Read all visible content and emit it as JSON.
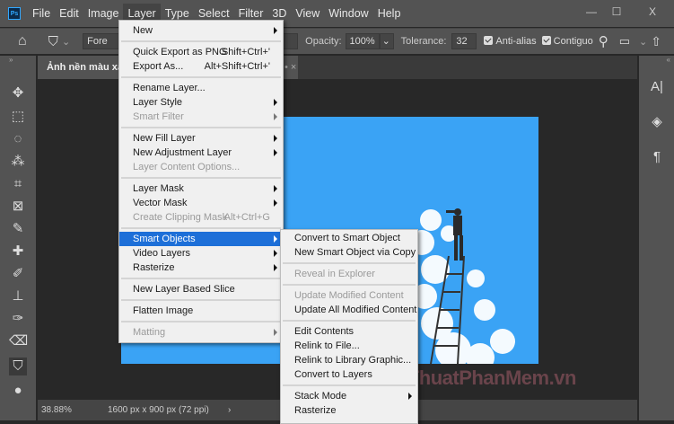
{
  "app": {
    "logo": "Ps"
  },
  "menubar": [
    "File",
    "Edit",
    "Image",
    "Layer",
    "Type",
    "Select",
    "Filter",
    "3D",
    "View",
    "Window",
    "Help"
  ],
  "window_controls": {
    "minimize": "—",
    "maximize": "☐",
    "close": "X"
  },
  "options": {
    "mode_value": "Fore",
    "opacity_label": "Opacity:",
    "opacity_value": "100%",
    "tolerance_label": "Tolerance:",
    "tolerance_value": "32",
    "antialias_label": "Anti-alias",
    "contiguous_label": "Contiguo"
  },
  "document": {
    "tab_title": "Ảnh nền màu xan",
    "zoom": "38.88%",
    "size_info": "1600 px x 900 px (72 ppi)"
  },
  "layer_menu": [
    {
      "label": "New",
      "submenu": true
    },
    {
      "sep": true
    },
    {
      "label": "Quick Export as PNG",
      "shortcut": "Shift+Ctrl+'"
    },
    {
      "label": "Export As...",
      "shortcut": "Alt+Shift+Ctrl+'"
    },
    {
      "sep": true
    },
    {
      "label": "Rename Layer..."
    },
    {
      "label": "Layer Style",
      "submenu": true
    },
    {
      "label": "Smart Filter",
      "submenu": true,
      "disabled": true
    },
    {
      "sep": true
    },
    {
      "label": "New Fill Layer",
      "submenu": true
    },
    {
      "label": "New Adjustment Layer",
      "submenu": true
    },
    {
      "label": "Layer Content Options...",
      "disabled": true
    },
    {
      "sep": true
    },
    {
      "label": "Layer Mask",
      "submenu": true
    },
    {
      "label": "Vector Mask",
      "submenu": true
    },
    {
      "label": "Create Clipping Mask",
      "shortcut": "Alt+Ctrl+G",
      "disabled": true
    },
    {
      "sep": true
    },
    {
      "label": "Smart Objects",
      "submenu": true,
      "highlighted": true
    },
    {
      "label": "Video Layers",
      "submenu": true
    },
    {
      "label": "Rasterize",
      "submenu": true
    },
    {
      "sep": true
    },
    {
      "label": "New Layer Based Slice"
    },
    {
      "sep": true
    },
    {
      "label": "Flatten Image"
    },
    {
      "sep": true
    },
    {
      "label": "Matting",
      "submenu": true,
      "disabled": true
    }
  ],
  "smart_objects_menu": [
    {
      "label": "Convert to Smart Object"
    },
    {
      "label": "New Smart Object via Copy"
    },
    {
      "sep": true
    },
    {
      "label": "Reveal in Explorer",
      "disabled": true
    },
    {
      "sep": true
    },
    {
      "label": "Update Modified Content",
      "disabled": true
    },
    {
      "label": "Update All Modified Content"
    },
    {
      "sep": true
    },
    {
      "label": "Edit Contents"
    },
    {
      "label": "Relink to File..."
    },
    {
      "label": "Relink to Library Graphic..."
    },
    {
      "label": "Convert to Layers"
    },
    {
      "sep": true
    },
    {
      "label": "Stack Mode",
      "submenu": true
    },
    {
      "label": "Rasterize"
    }
  ],
  "watermark": "ThuThuatPhanMem.vn",
  "colors": {
    "canvas_blue": "#3aa3f5",
    "highlight": "#1d6fd8",
    "chrome": "#535353"
  }
}
